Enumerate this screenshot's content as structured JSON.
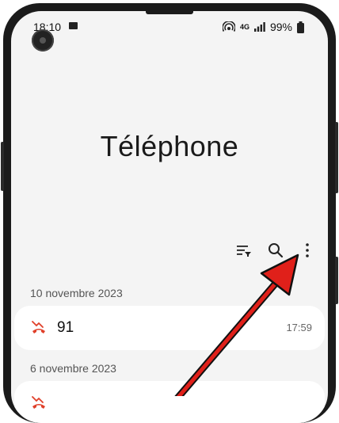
{
  "status_bar": {
    "time": "18:10",
    "network": "4G",
    "battery": "99%"
  },
  "app": {
    "title": "Téléphone"
  },
  "toolbar": {
    "filter_icon": "filter-icon",
    "search_icon": "search-icon",
    "more_icon": "more-options-icon"
  },
  "call_log": [
    {
      "date": "10 novembre 2023",
      "calls": [
        {
          "number": "91",
          "time": "17:59",
          "type": "missed"
        }
      ]
    },
    {
      "date": "6 novembre 2023",
      "calls": [
        {
          "number": "",
          "time": "",
          "type": "missed"
        }
      ]
    }
  ],
  "colors": {
    "missed_call": "#e0402a",
    "annotation_arrow": "#e0201a",
    "background": "#f4f4f4"
  }
}
